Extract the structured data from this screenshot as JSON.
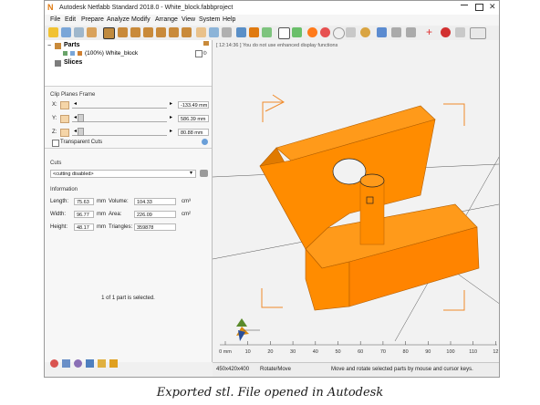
{
  "window": {
    "title": "Autodesk Netfabb Standard 2018.0 - White_block.fabbproject"
  },
  "menu": {
    "items": [
      "File",
      "Edit",
      "Prepare",
      "Analyze",
      "Modify",
      "Arrange",
      "View",
      "System",
      "Help"
    ]
  },
  "tree": {
    "parts_label": "Parts",
    "part_item": "(100%) White_block",
    "slices_label": "Slices"
  },
  "clip": {
    "title": "Clip Planes Frame",
    "x_label": "X:",
    "x_value": "-133.49 mm",
    "y_label": "Y:",
    "y_value": "586.39 mm",
    "z_label": "Z:",
    "z_value": "80.88 mm",
    "transparent_label": "Transparent Cuts"
  },
  "cuts": {
    "title": "Cuts",
    "dropdown_value": "<cutting disabled>"
  },
  "info": {
    "title": "Information",
    "length_label": "Length:",
    "length_value": "75.63",
    "length_unit": "mm",
    "width_label": "Width:",
    "width_value": "96.77",
    "width_unit": "mm",
    "height_label": "Height:",
    "height_value": "48.17",
    "height_unit": "mm",
    "volume_label": "Volume:",
    "volume_value": "104.33",
    "volume_unit": "cm³",
    "area_label": "Area:",
    "area_value": "226.09",
    "area_unit": "cm²",
    "triangles_label": "Triangles:",
    "triangles_value": "359878",
    "selected_text": "1 of 1 part is selected."
  },
  "viewport": {
    "message": "[ 12:14:36 ]  You do not use enhanced display functions",
    "ruler": [
      "0 mm",
      "10",
      "20",
      "30",
      "40",
      "50",
      "60",
      "70",
      "80",
      "90",
      "100",
      "110",
      "12"
    ]
  },
  "status": {
    "dims": "450x420x400",
    "mode": "Rotate/Move",
    "hint": "Move and rotate selected parts by mouse and cursor keys."
  },
  "caption": "Exported stl. File opened in Autodesk",
  "colors": {
    "part": "#ff8c00",
    "part_dark": "#e07a00",
    "guides": "#f08a2a"
  }
}
